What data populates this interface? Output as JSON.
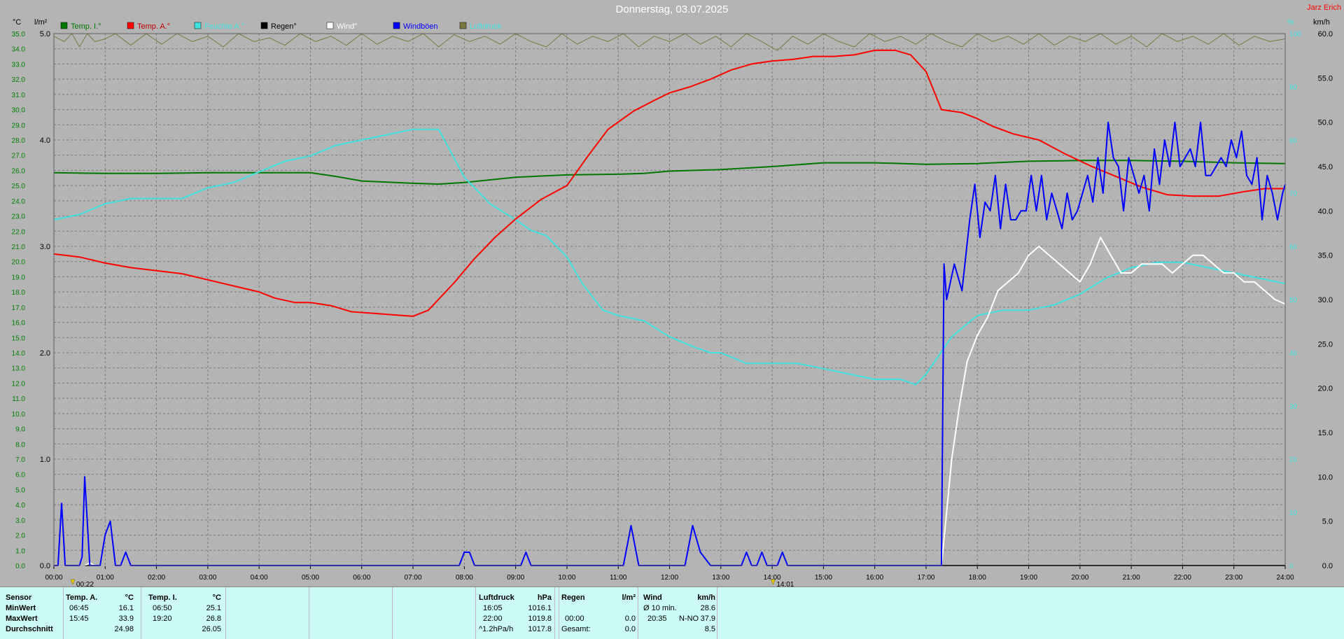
{
  "header": {
    "title": "Donnerstag, 03.07.2025",
    "author": "Jarz Erich",
    "unit_temp": "°C",
    "unit_rain": "l/m²",
    "unit_humidity": "%",
    "unit_wind": "km/h"
  },
  "colors": {
    "temp_inside": "#007800",
    "temp_outside": "#ff0000",
    "humidity": "#40e0e0",
    "rain": "#000000",
    "wind": "#ffffff",
    "gusts": "#0000ff",
    "pressure": "#7a7a40",
    "background": "#b4b4b4",
    "stats_background": "#ccfbf6"
  },
  "legend": [
    {
      "label": "Temp. I.°",
      "color": "#007800",
      "text_color": "#007800"
    },
    {
      "label": "Temp. A.°",
      "color": "#ff0000",
      "text_color": "#c00000"
    },
    {
      "label": "Feuchte A.°",
      "color": "#40e0e0",
      "text_color": "#40e0e0"
    },
    {
      "label": "Regen°",
      "color": "#000000",
      "text_color": "#000000"
    },
    {
      "label": "Wind°",
      "color": "#ffffff",
      "text_color": "#ffffff"
    },
    {
      "label": "Windböen",
      "color": "#0000ff",
      "text_color": "#0000ff"
    },
    {
      "label": "Luftdruck",
      "color": "#7a7a40",
      "text_color": "#40e0e0"
    }
  ],
  "markers": [
    {
      "label": "00:22",
      "hour": 0.367
    },
    {
      "label": "14:01",
      "hour": 14.017
    }
  ],
  "chart_data": {
    "type": "line",
    "title": "Donnerstag, 03.07.2025",
    "x_ticks": [
      "00:00",
      "01:00",
      "02:00",
      "03:00",
      "04:00",
      "05:00",
      "06:00",
      "07:00",
      "08:00",
      "09:00",
      "10:00",
      "11:00",
      "12:00",
      "13:00",
      "14:00",
      "15:00",
      "16:00",
      "17:00",
      "18:00",
      "19:00",
      "20:00",
      "21:00",
      "22:00",
      "23:00",
      "24:00"
    ],
    "xlim": [
      0,
      24
    ],
    "axes": {
      "temp": {
        "unit": "°C",
        "ylim": [
          0,
          35
        ],
        "ticks": [
          "0.0",
          "1.0",
          "2.0",
          "3.0",
          "4.0",
          "5.0",
          "6.0",
          "7.0",
          "8.0",
          "9.0",
          "10.0",
          "11.0",
          "12.0",
          "13.0",
          "14.0",
          "15.0",
          "16.0",
          "17.0",
          "18.0",
          "19.0",
          "20.0",
          "21.0",
          "22.0",
          "23.0",
          "24.0",
          "25.0",
          "26.0",
          "27.0",
          "28.0",
          "29.0",
          "30.0",
          "31.0",
          "32.0",
          "33.0",
          "34.0",
          "35.0"
        ]
      },
      "rain": {
        "unit": "l/m²",
        "ylim": [
          0,
          5
        ],
        "ticks": [
          "0.0",
          "1.0",
          "2.0",
          "3.0",
          "4.0",
          "5.0"
        ]
      },
      "humidity": {
        "unit": "%",
        "ylim": [
          0,
          100
        ],
        "ticks": [
          "0",
          "10",
          "20",
          "30",
          "40",
          "50",
          "60",
          "70",
          "80",
          "90",
          "100"
        ]
      },
      "wind": {
        "unit": "km/h",
        "ylim": [
          0,
          60
        ],
        "ticks": [
          "0.0",
          "5.0",
          "10.0",
          "15.0",
          "20.0",
          "25.0",
          "30.0",
          "35.0",
          "40.0",
          "45.0",
          "50.0",
          "55.0",
          "60.0"
        ]
      }
    },
    "series": [
      {
        "name": "Temp. I.°",
        "axis": "temp",
        "color": "#007800",
        "x": [
          0,
          1,
          2,
          3,
          4,
          5,
          5.5,
          6,
          7,
          7.5,
          8,
          9,
          10,
          11,
          11.5,
          12,
          13,
          14,
          15,
          16,
          17,
          18,
          19,
          20,
          21,
          22,
          23,
          24
        ],
        "y": [
          25.85,
          25.8,
          25.8,
          25.85,
          25.85,
          25.85,
          25.6,
          25.3,
          25.15,
          25.1,
          25.2,
          25.55,
          25.7,
          25.75,
          25.8,
          25.95,
          26.05,
          26.25,
          26.5,
          26.5,
          26.4,
          26.45,
          26.6,
          26.65,
          26.65,
          26.6,
          26.5,
          26.45
        ]
      },
      {
        "name": "Temp. A.°",
        "axis": "temp",
        "color": "#ff0000",
        "x": [
          0,
          0.5,
          1,
          1.5,
          2,
          2.5,
          3,
          3.5,
          4,
          4.3,
          4.7,
          5,
          5.4,
          5.8,
          6.2,
          6.6,
          7,
          7.3,
          7.8,
          8.2,
          8.6,
          9,
          9.5,
          10,
          10.4,
          10.8,
          11.3,
          11.7,
          12,
          12.4,
          12.8,
          13.2,
          13.6,
          14,
          14.4,
          14.8,
          15.2,
          15.6,
          16,
          16.4,
          16.7,
          17,
          17.3,
          17.7,
          18,
          18.3,
          18.7,
          19.2,
          19.7,
          20.2,
          20.7,
          21.2,
          21.7,
          22.2,
          22.7,
          23.2,
          23.6,
          24
        ],
        "y": [
          20.5,
          20.3,
          19.9,
          19.6,
          19.4,
          19.2,
          18.8,
          18.4,
          18.0,
          17.6,
          17.3,
          17.3,
          17.1,
          16.7,
          16.6,
          16.5,
          16.4,
          16.8,
          18.6,
          20.2,
          21.6,
          22.8,
          24.1,
          25.0,
          26.9,
          28.7,
          29.9,
          30.6,
          31.1,
          31.5,
          32.0,
          32.6,
          33.0,
          33.2,
          33.3,
          33.5,
          33.5,
          33.6,
          33.9,
          33.9,
          33.6,
          32.5,
          30.0,
          29.8,
          29.4,
          28.9,
          28.4,
          28.0,
          27.1,
          26.3,
          25.6,
          24.9,
          24.4,
          24.3,
          24.3,
          24.6,
          24.8,
          24.8
        ]
      },
      {
        "name": "Feuchte A.°",
        "axis": "humidity",
        "color": "#40e0e0",
        "x": [
          0,
          0.5,
          1,
          1.5,
          2,
          2.5,
          3,
          3.5,
          4,
          4.5,
          5,
          5.5,
          6,
          6.5,
          7,
          7.5,
          8,
          8.5,
          9,
          9.3,
          9.6,
          10,
          10.3,
          10.7,
          11,
          11.5,
          12,
          12.5,
          12.8,
          13,
          13.5,
          14,
          14.5,
          15,
          15.5,
          16,
          16.5,
          16.8,
          17,
          17.5,
          18,
          18.5,
          19,
          19.5,
          20,
          20.5,
          21,
          21.5,
          22,
          22.5,
          23,
          23.5,
          24
        ],
        "y": [
          65,
          66,
          68,
          69,
          69,
          69,
          71,
          72,
          74,
          76,
          77,
          79,
          80,
          81,
          82,
          82,
          73,
          68,
          65,
          63,
          62,
          58,
          53,
          48,
          47,
          46,
          43,
          41,
          40,
          40,
          38,
          38,
          38,
          37,
          36,
          35,
          35,
          34,
          36,
          43,
          47,
          48,
          48,
          49,
          51,
          54,
          56,
          57,
          57,
          56,
          55,
          54,
          53
        ]
      },
      {
        "name": "Wind°",
        "axis": "wind",
        "color": "#ffffff",
        "x": [
          0,
          0.6,
          0.7,
          0.8,
          16.5,
          17.3,
          17.4,
          17.5,
          17.65,
          17.8,
          18,
          18.2,
          18.4,
          18.6,
          18.8,
          19,
          19.2,
          19.4,
          19.6,
          19.8,
          20,
          20.2,
          20.4,
          20.6,
          20.8,
          21,
          21.2,
          21.4,
          21.6,
          21.8,
          22,
          22.2,
          22.4,
          22.6,
          22.8,
          23,
          23.2,
          23.4,
          23.6,
          23.8,
          24
        ],
        "y": [
          0,
          0,
          0.3,
          0,
          0,
          0,
          6,
          12,
          18,
          23,
          26,
          28,
          31,
          32,
          33,
          35,
          36,
          35,
          34,
          33,
          32,
          34,
          37,
          35,
          33,
          33,
          34,
          34,
          34,
          33,
          34,
          35,
          35,
          34,
          33,
          33,
          32,
          32,
          31,
          30,
          29.5
        ]
      },
      {
        "name": "Windböen",
        "axis": "wind",
        "color": "#0000ff",
        "x": [
          0,
          0.08,
          0.15,
          0.22,
          0.3,
          0.4,
          0.5,
          0.55,
          0.6,
          0.7,
          0.8,
          0.9,
          1.0,
          1.1,
          1.2,
          1.3,
          1.4,
          1.5,
          1.6,
          1.8,
          7.9,
          8.0,
          8.1,
          8.2,
          9.1,
          9.2,
          9.3,
          11.1,
          11.25,
          11.4,
          12.3,
          12.45,
          12.6,
          12.8,
          13.4,
          13.5,
          13.6,
          13.7,
          13.8,
          13.9,
          14.1,
          14.2,
          14.3,
          17.3,
          17.35,
          17.4,
          17.55,
          17.7,
          17.85,
          17.95,
          18.05,
          18.15,
          18.25,
          18.35,
          18.45,
          18.55,
          18.65,
          18.75,
          18.85,
          18.95,
          19.05,
          19.15,
          19.25,
          19.35,
          19.45,
          19.55,
          19.65,
          19.75,
          19.85,
          19.95,
          20.05,
          20.15,
          20.25,
          20.35,
          20.45,
          20.55,
          20.65,
          20.75,
          20.85,
          20.95,
          21.05,
          21.15,
          21.25,
          21.35,
          21.45,
          21.55,
          21.65,
          21.75,
          21.85,
          21.95,
          22.05,
          22.15,
          22.25,
          22.35,
          22.45,
          22.55,
          22.65,
          22.75,
          22.85,
          22.95,
          23.05,
          23.15,
          23.25,
          23.35,
          23.45,
          23.55,
          23.65,
          23.75,
          23.85,
          23.95,
          24
        ],
        "y": [
          0,
          0,
          7,
          0,
          0,
          0,
          0,
          1,
          10,
          0,
          0,
          0,
          3.5,
          5,
          0,
          0,
          1.5,
          0,
          0,
          0,
          0,
          1.5,
          1.5,
          0,
          0,
          1.5,
          0,
          0,
          4.5,
          0,
          0,
          4.5,
          1.5,
          0,
          0,
          1.5,
          0,
          0,
          1.5,
          0,
          0,
          1.5,
          0,
          0,
          34,
          30,
          34,
          31,
          39,
          43,
          37,
          41,
          40,
          44,
          38,
          43,
          39,
          39,
          40,
          40,
          44,
          40,
          44,
          39,
          42,
          40,
          38,
          42,
          39,
          40,
          42,
          44,
          41,
          46,
          42,
          50,
          46,
          45,
          40,
          46,
          44,
          42,
          44,
          40,
          47,
          43,
          48,
          45,
          50,
          45,
          46,
          47,
          45,
          50,
          44,
          44,
          45,
          46,
          45,
          48,
          46,
          49,
          44,
          43,
          46,
          39,
          44,
          42,
          39,
          42,
          43
        ]
      },
      {
        "name": "Regen°",
        "axis": "rain",
        "color": "#000000",
        "x": [
          0,
          24
        ],
        "y": [
          0,
          0
        ]
      },
      {
        "name": "Luftdruck",
        "axis": "humidity",
        "color": "#7a7a40",
        "x": [
          0,
          0.2,
          0.35,
          0.5,
          0.65,
          0.8,
          1.0,
          1.2,
          1.5,
          1.8,
          2.1,
          2.4,
          2.7,
          3.0,
          3.3,
          3.6,
          3.9,
          4.2,
          4.5,
          4.8,
          5.1,
          5.4,
          5.7,
          6.0,
          6.3,
          6.6,
          6.9,
          7.2,
          7.5,
          7.8,
          8.1,
          8.4,
          8.7,
          9.0,
          9.3,
          9.6,
          9.9,
          10.2,
          10.5,
          10.8,
          11.1,
          11.4,
          11.7,
          12.0,
          12.3,
          12.6,
          12.9,
          13.2,
          13.5,
          13.8,
          14.1,
          14.4,
          14.7,
          15.0,
          15.3,
          15.6,
          15.9,
          16.2,
          16.5,
          16.8,
          17.1,
          17.4,
          17.7,
          18.0,
          18.3,
          18.6,
          18.9,
          19.2,
          19.5,
          19.8,
          20.1,
          20.4,
          20.7,
          21.0,
          21.3,
          21.6,
          21.9,
          22.2,
          22.5,
          22.8,
          23.1,
          23.4,
          23.7,
          24
        ],
        "y": [
          99.5,
          98.5,
          100,
          97.5,
          100,
          98.5,
          99,
          100,
          97.8,
          100,
          98,
          100,
          98.5,
          99.5,
          97.5,
          100,
          98.5,
          99.2,
          97.8,
          100,
          98.5,
          99.5,
          97.8,
          100,
          98,
          99.5,
          98.5,
          100,
          97.5,
          99.8,
          98.5,
          99.5,
          98,
          100,
          98.5,
          97.5,
          100,
          98,
          99.5,
          98.5,
          100,
          97.5,
          99.5,
          98.5,
          100,
          98,
          99.5,
          97.5,
          100,
          98.5,
          96.8,
          99.5,
          98,
          100,
          98.5,
          97.5,
          100,
          98.5,
          99.5,
          98,
          100,
          98.5,
          97.5,
          100,
          98.5,
          99.5,
          98,
          100,
          97.8,
          99.5,
          98.5,
          100,
          98,
          99.5,
          97.5,
          100,
          98.5,
          99.5,
          98,
          100,
          97.8,
          99.5,
          98.5,
          99
        ]
      }
    ]
  },
  "stats": {
    "sensor_label": "Sensor",
    "min_label": "MinWert",
    "max_label": "MaxWert",
    "avg_label": "Durchschnitt",
    "temp_a": {
      "title": "Temp. A.",
      "unit": "°C",
      "min_time": "06:45",
      "min_val": "16.1",
      "max_time": "15:45",
      "max_val": "33.9",
      "avg": "24.98"
    },
    "temp_i": {
      "title": "Temp. I.",
      "unit": "°C",
      "min_time": "06:50",
      "min_val": "25.1",
      "max_time": "19:20",
      "max_val": "26.8",
      "avg": "26.05"
    },
    "pressure": {
      "title": "Luftdruck",
      "unit": "hPa",
      "min_time": "16:05",
      "min_val": "1016.1",
      "max_time": "22:00",
      "max_val": "1019.8",
      "trend_label": "^1.2hPa/h",
      "trend_val": "1017.8"
    },
    "rain": {
      "title": "Regen",
      "unit": "l/m²",
      "max_time": "00:00",
      "max_val": "0.0",
      "total_label": "Gesamt:",
      "total_val": "0.0"
    },
    "wind": {
      "title": "Wind",
      "unit": "km/h",
      "avg10_label": "Ø 10 min.",
      "avg10_val": "28.6",
      "max_time": "20:35",
      "max_dir": "N-NO",
      "max_val": "37.9",
      "avg": "8.5"
    }
  }
}
